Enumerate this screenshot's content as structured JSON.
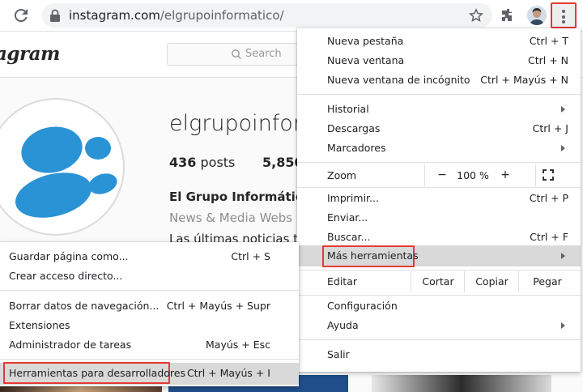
{
  "browser": {
    "url_domain": "instagram.com",
    "url_path": "/elgrupoinformatico/"
  },
  "instagram": {
    "logo": "agram",
    "search_placeholder": "Search",
    "username": "elgrupoinfor.",
    "posts_count": "436",
    "posts_label": "posts",
    "followers_count": "5,850",
    "bio_name": "El Grupo Informático",
    "bio_category": "News & Media Webs",
    "bio_text": "Las últimas noticias te"
  },
  "menu": {
    "items": [
      {
        "label": "Nueva pestaña",
        "shortcut": "Ctrl + T"
      },
      {
        "label": "Nueva ventana",
        "shortcut": "Ctrl + N"
      },
      {
        "label": "Nueva ventana de incógnito",
        "shortcut": "Ctrl + Mayús + N"
      },
      {
        "label": "Historial",
        "shortcut": ""
      },
      {
        "label": "Descargas",
        "shortcut": "Ctrl + J"
      },
      {
        "label": "Marcadores",
        "shortcut": ""
      },
      {
        "label": "Imprimir...",
        "shortcut": "Ctrl + P"
      },
      {
        "label": "Enviar...",
        "shortcut": ""
      },
      {
        "label": "Buscar...",
        "shortcut": "Ctrl + F"
      },
      {
        "label": "Más herramientas",
        "shortcut": ""
      },
      {
        "label": "Configuración",
        "shortcut": ""
      },
      {
        "label": "Ayuda",
        "shortcut": ""
      },
      {
        "label": "Salir",
        "shortcut": ""
      }
    ],
    "zoom": {
      "label": "Zoom",
      "minus": "−",
      "value": "100 %",
      "plus": "+"
    },
    "edit": {
      "label": "Editar",
      "cut": "Cortar",
      "copy": "Copiar",
      "paste": "Pegar"
    }
  },
  "submenu": {
    "items": [
      {
        "label": "Guardar página como...",
        "shortcut": "Ctrl + S"
      },
      {
        "label": "Crear acceso directo...",
        "shortcut": ""
      },
      {
        "label": "Borrar datos de navegación...",
        "shortcut": "Ctrl + Mayús + Supr"
      },
      {
        "label": "Extensiones",
        "shortcut": ""
      },
      {
        "label": "Administrador de tareas",
        "shortcut": "Mayús + Esc"
      },
      {
        "label": "Herramientas para desarrolladores",
        "shortcut": "Ctrl + Mayús + I"
      }
    ]
  },
  "icons": {
    "reload": "reload-icon",
    "lock": "lock-icon",
    "star": "bookmark-star-icon",
    "extensions": "puzzle-icon",
    "menu": "kebab-menu-icon",
    "fullscreen": "fullscreen-icon",
    "submenu_arrow": "chevron-right-icon"
  },
  "colors": {
    "highlight_border": "#e53935",
    "hover_background": "#d9d9d9",
    "logo_blue": "#2a93d5"
  }
}
